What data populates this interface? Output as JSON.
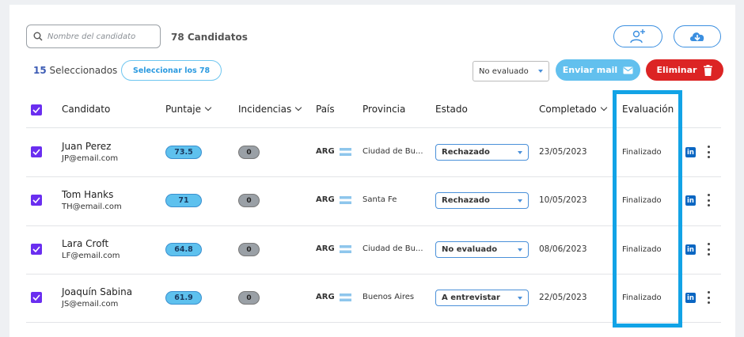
{
  "toolbar": {
    "search_placeholder": "Nombre del candidato",
    "count_label": "78 Candidatos",
    "add_icon": "add-user-icon",
    "download_icon": "cloud-download-icon"
  },
  "selection": {
    "count": "15",
    "label": "Seleccionados",
    "select_all_label": "Seleccionar los 78"
  },
  "actions": {
    "filter_value": "No evaluado",
    "mail_label": "Enviar mail",
    "delete_label": "Eliminar"
  },
  "table": {
    "headers": {
      "candidato": "Candidato",
      "puntaje": "Puntaje",
      "incidencias": "Incidencias",
      "pais": "País",
      "provincia": "Provincia",
      "estado": "Estado",
      "completado": "Completado",
      "evaluacion": "Evaluación"
    },
    "rows": [
      {
        "name": "Juan Perez",
        "email": "JP@email.com",
        "score": "73.5",
        "incidents": "0",
        "country": "ARG",
        "province": "Ciudad de Bu...",
        "status": "Rechazado",
        "completed": "23/05/2023",
        "evaluation": "Finalizado"
      },
      {
        "name": "Tom Hanks",
        "email": "TH@email.com",
        "score": "71",
        "incidents": "0",
        "country": "ARG",
        "province": "Santa Fe",
        "status": "Rechazado",
        "completed": "10/05/2023",
        "evaluation": "Finalizado"
      },
      {
        "name": "Lara Croft",
        "email": "LF@email.com",
        "score": "64.8",
        "incidents": "0",
        "country": "ARG",
        "province": "Ciudad de Bu...",
        "status": "No evaluado",
        "completed": "08/06/2023",
        "evaluation": "Finalizado"
      },
      {
        "name": "Joaquín Sabina",
        "email": "JS@email.com",
        "score": "61.9",
        "incidents": "0",
        "country": "ARG",
        "province": "Buenos Aires",
        "status": "A entrevistar",
        "completed": "22/05/2023",
        "evaluation": "Finalizado"
      }
    ]
  },
  "colors": {
    "accent": "#6a2ef0",
    "highlight": "#12a3e6",
    "mail": "#62c0ee",
    "delete": "#dc2424",
    "score": "#5ec1ee"
  }
}
